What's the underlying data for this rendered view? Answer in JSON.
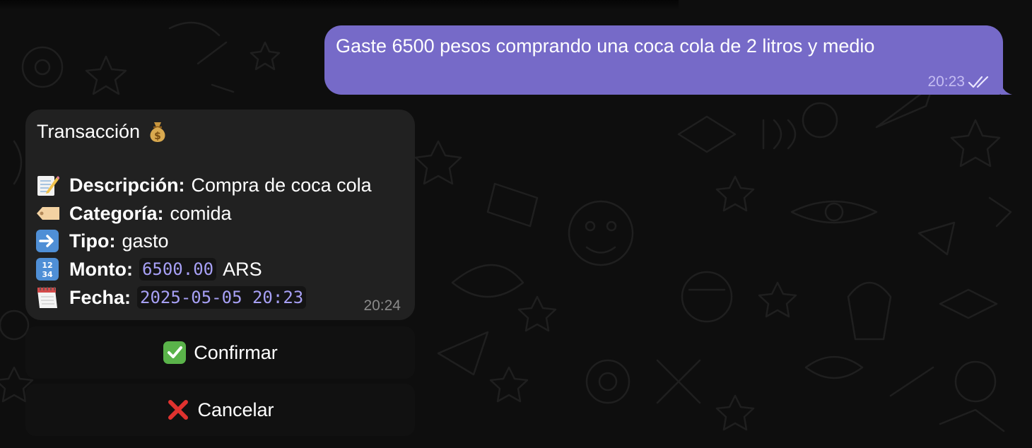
{
  "outgoing_message": {
    "text": "Gaste 6500 pesos comprando una coca cola de 2 litros y medio",
    "time": "20:23",
    "status_icon": "double-check-icon"
  },
  "incoming_message": {
    "title": "Transacción",
    "title_icon": "money-bag-icon",
    "fields": [
      {
        "icon": "memo-icon",
        "label": "Descripción:",
        "value": "Compra de coca cola"
      },
      {
        "icon": "label-tag-icon",
        "label": "Categoría:",
        "value": "comida"
      },
      {
        "icon": "right-arrow-icon",
        "label": "Tipo:",
        "value": "gasto"
      },
      {
        "icon": "input-numbers-icon",
        "label": "Monto:",
        "value": "6500.00",
        "suffix": "ARS"
      },
      {
        "icon": "calendar-icon",
        "label": "Fecha:",
        "value": "2025-05-05 20:23"
      }
    ],
    "time": "20:24"
  },
  "keyboard": {
    "confirm_label": "Confirmar",
    "confirm_icon": "check-mark-icon",
    "cancel_label": "Cancelar",
    "cancel_icon": "cross-mark-icon"
  },
  "colors": {
    "outgoing_bubble": "#766ac8",
    "incoming_bubble": "#212121",
    "background": "#0e0e0e",
    "code_text": "#a7a0f5"
  }
}
